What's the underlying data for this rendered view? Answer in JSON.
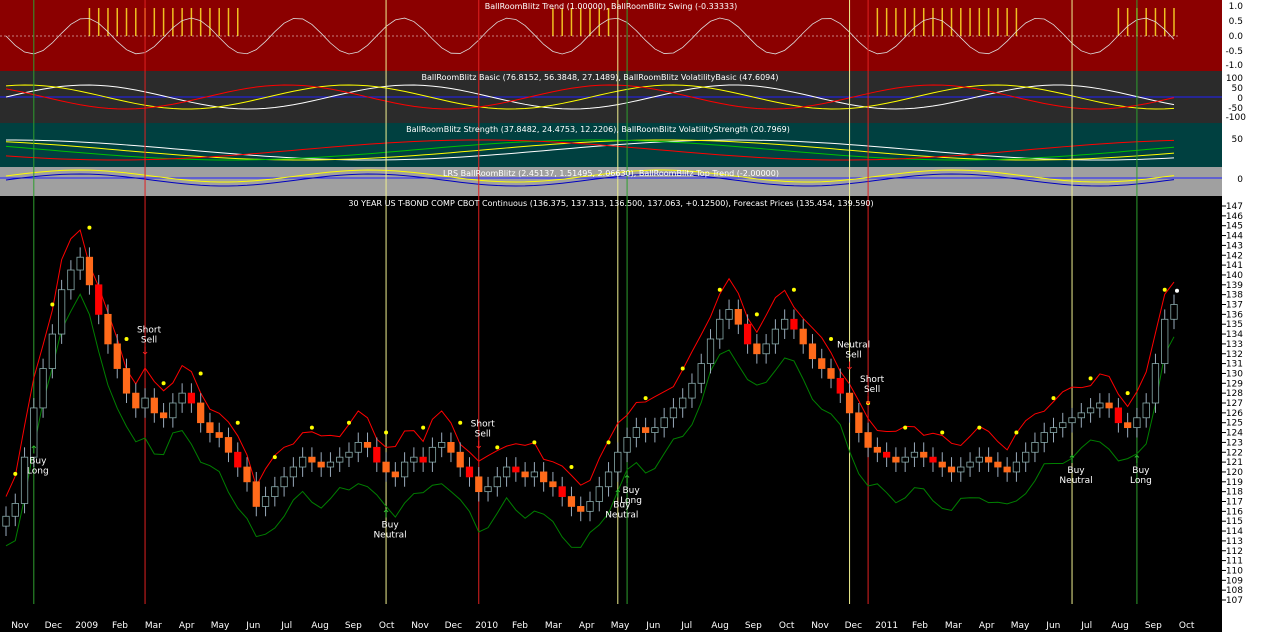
{
  "panels": {
    "trend": {
      "title": "BallRoomBlitz Trend (1.00000), BallRoomBlitz Swing (-0.33333)",
      "ticks": [
        "1.0",
        "0.5",
        "0.0",
        "-0.5",
        "-1.0"
      ],
      "background": "#8b0000"
    },
    "basic": {
      "title": "BallRoomBlitz Basic (76.8152, 56.3848, 27.1489), BallRoomBlitz VolatilityBasic (47.6094)",
      "ticks": [
        "100",
        "50",
        "0",
        "-50",
        "-100"
      ],
      "background": "#2b2b2b"
    },
    "strength": {
      "title": "BallRoomBlitz Strength (37.8482, 24.4753, 12.2206), BallRoomBlitz VolatilityStrength (20.7969)",
      "ticks": [
        "50"
      ],
      "background": "#004040"
    },
    "lrs": {
      "title": "LRS BallRoomBlitz (2.45137, 1.51495, 2.06630), BallRoomBlitz Top Trend (-2.00000)",
      "ticks": [
        "0"
      ],
      "background": "#a0a0a0"
    },
    "price": {
      "title": "30 YEAR US T-BOND COMP CBOT Continuous (136.375, 137.313, 136.500, 137.063, +0.12500), Forecast Prices (135.454, 139.590)",
      "background": "#000000"
    }
  },
  "chart_data": {
    "type": "candlestick",
    "ylim": [
      107,
      147
    ],
    "yticks": [
      147,
      146,
      145,
      144,
      143,
      142,
      141,
      140,
      139,
      138,
      137,
      136,
      135,
      134,
      133,
      132,
      131,
      130,
      129,
      128,
      127,
      126,
      125,
      124,
      123,
      122,
      121,
      120,
      119,
      118,
      117,
      116,
      115,
      114,
      113,
      112,
      111,
      110,
      109,
      108,
      107
    ],
    "months": [
      "Nov",
      "Dec",
      "2009",
      "Feb",
      "Mar",
      "Apr",
      "May",
      "Jun",
      "Jul",
      "Aug",
      "Sep",
      "Oct",
      "Nov",
      "Dec",
      "2010",
      "Feb",
      "Mar",
      "Apr",
      "May",
      "Jun",
      "Jul",
      "Aug",
      "Sep",
      "Oct",
      "Nov",
      "Dec",
      "2011",
      "Feb",
      "Mar",
      "Apr",
      "May",
      "Jun",
      "Jul",
      "Aug",
      "Sep",
      "Oct"
    ],
    "closes": [
      115.5,
      116.8,
      121.5,
      126.5,
      130.5,
      134.0,
      138.5,
      140.5,
      141.8,
      139.0,
      136.0,
      133.0,
      130.5,
      128.0,
      126.5,
      127.5,
      126.0,
      125.5,
      127.0,
      128.0,
      127.0,
      125.0,
      124.0,
      123.5,
      122.0,
      120.5,
      119.0,
      116.5,
      117.5,
      118.5,
      119.5,
      120.5,
      121.5,
      121.0,
      120.5,
      121.0,
      121.5,
      122.0,
      123.0,
      122.5,
      121.0,
      120.0,
      119.5,
      121.0,
      121.5,
      121.0,
      122.5,
      123.0,
      122.0,
      120.5,
      119.5,
      118.0,
      118.5,
      119.5,
      120.5,
      120.0,
      119.5,
      120.0,
      119.0,
      118.5,
      117.5,
      116.5,
      116.0,
      117.0,
      118.5,
      120.0,
      122.0,
      123.5,
      124.5,
      124.0,
      124.5,
      125.5,
      126.5,
      127.5,
      129.0,
      131.0,
      133.5,
      135.5,
      136.5,
      135.0,
      133.0,
      132.0,
      133.0,
      134.5,
      135.5,
      134.5,
      133.0,
      131.5,
      130.5,
      129.5,
      128.0,
      126.0,
      124.0,
      122.5,
      122.0,
      121.5,
      121.0,
      121.5,
      122.0,
      121.5,
      121.0,
      120.5,
      120.0,
      120.5,
      121.0,
      121.5,
      121.0,
      120.5,
      120.0,
      121.0,
      122.0,
      123.0,
      124.0,
      124.5,
      125.0,
      125.5,
      126.0,
      126.5,
      127.0,
      126.5,
      125.0,
      124.5,
      125.5,
      127.0,
      131.0,
      135.5,
      137.0
    ],
    "signals": [
      {
        "label": [
          "Buy",
          "Long"
        ],
        "dir": "up",
        "bar": 3
      },
      {
        "label": [
          "Short",
          "Sell"
        ],
        "dir": "down",
        "bar": 15
      },
      {
        "label": [
          "Buy",
          "Neutral"
        ],
        "dir": "up",
        "bar": 41
      },
      {
        "label": [
          "Short",
          "Sell"
        ],
        "dir": "down",
        "bar": 51
      },
      {
        "label": [
          "Buy",
          "Long"
        ],
        "dir": "up",
        "bar": 67
      },
      {
        "label": [
          "Buy",
          "Neutral"
        ],
        "dir": "up",
        "bar": 66
      },
      {
        "label": [
          "Neutral",
          "Sell"
        ],
        "dir": "down",
        "bar": 91
      },
      {
        "label": [
          "Short",
          "Sell"
        ],
        "dir": "down",
        "bar": 93
      },
      {
        "label": [
          "Buy",
          "Neutral"
        ],
        "dir": "up",
        "bar": 115
      },
      {
        "label": [
          "Buy",
          "Long"
        ],
        "dir": "up",
        "bar": 122
      }
    ],
    "green_vlines_bar": [
      3,
      67,
      122
    ],
    "red_vlines_bar": [
      15,
      51,
      93
    ],
    "yellow_vlines_bar": [
      41,
      66,
      91,
      115
    ],
    "colors": {
      "up": "#ffffff",
      "down": "#ff6a1a",
      "strong_down": "#ff0000",
      "upper_band": "#ff0000",
      "lower_band": "#008000",
      "dots": "#ffff00"
    }
  }
}
